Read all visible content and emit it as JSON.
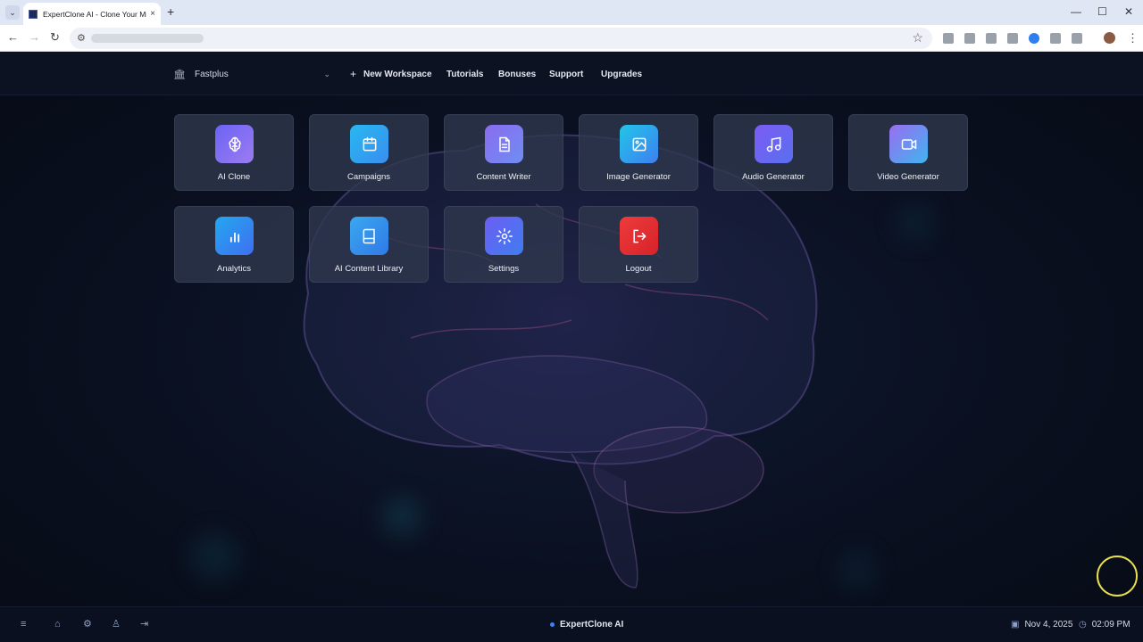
{
  "browser": {
    "tab_title": "ExpertClone AI - Clone Your Mi",
    "tab_close": "×",
    "new_tab": "+",
    "menu_glyph": "⌄",
    "back": "←",
    "forward": "→",
    "reload": "↻",
    "site_info": "⚙",
    "star": "☆",
    "kebab": "⋮",
    "minimize": "—",
    "maximize": "☐",
    "close": "✕"
  },
  "topnav": {
    "workspace_icon": "🏛",
    "workspace": "Fastplus",
    "workspace_chevron": "⌄",
    "new_workspace_plus": "+",
    "new_workspace": "New Workspace",
    "tutorials": "Tutorials",
    "bonuses": "Bonuses",
    "support": "Support",
    "upgrades": "Upgrades"
  },
  "tiles": [
    {
      "label": "AI Clone",
      "icon": "brain-icon"
    },
    {
      "label": "Campaigns",
      "icon": "calendar-icon"
    },
    {
      "label": "Content Writer",
      "icon": "document-icon"
    },
    {
      "label": "Image Generator",
      "icon": "image-icon"
    },
    {
      "label": "Audio Generator",
      "icon": "music-icon"
    },
    {
      "label": "Video Generator",
      "icon": "video-icon"
    },
    {
      "label": "Analytics",
      "icon": "bar-chart-icon"
    },
    {
      "label": "AI Content Library",
      "icon": "book-icon"
    },
    {
      "label": "Settings",
      "icon": "gear-icon"
    },
    {
      "label": "Logout",
      "icon": "logout-icon"
    }
  ],
  "bottombar": {
    "menu": "≡",
    "home": "⌂",
    "settings": "⚙",
    "user": "♙",
    "logout": "⇥",
    "brand": "ExpertClone AI",
    "date_icon": "▣",
    "date": "Nov 4, 2025",
    "time_icon": "◷",
    "time": "02:09 PM"
  },
  "colors": {
    "background": "#0b0f1c",
    "tile": "#30384e",
    "logout": "#e23333",
    "accent": "#3b82f6"
  }
}
